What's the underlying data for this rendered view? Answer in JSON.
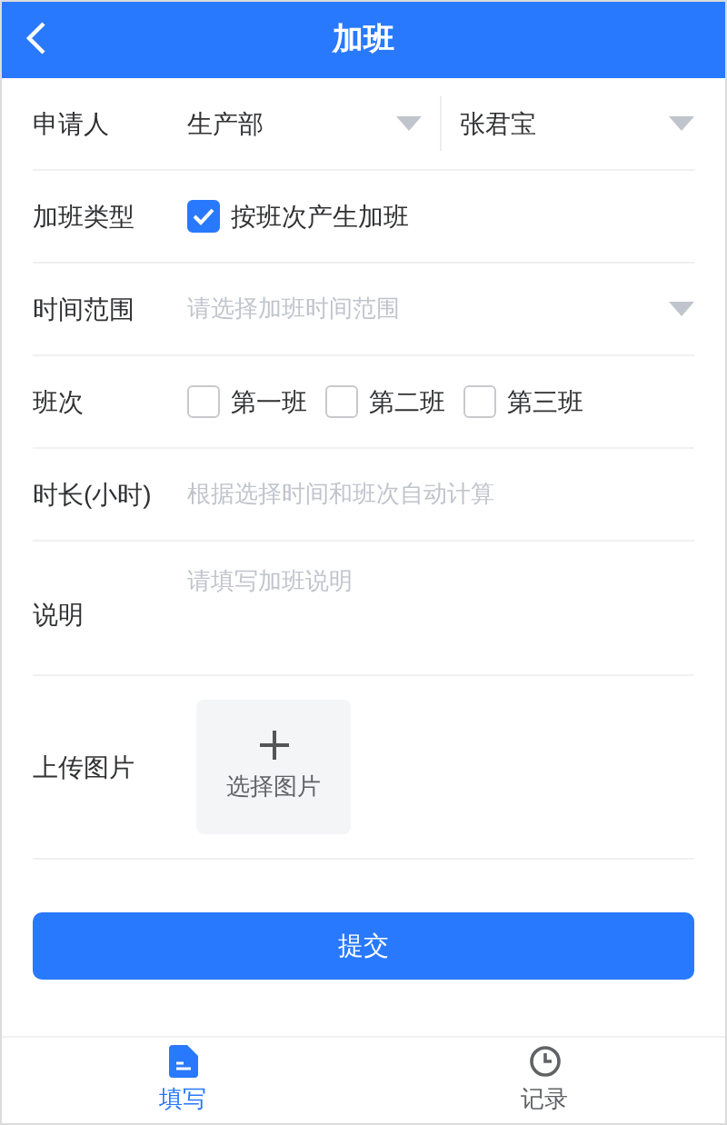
{
  "header": {
    "title": "加班"
  },
  "applicant": {
    "label": "申请人",
    "department": "生产部",
    "person": "张君宝"
  },
  "type": {
    "label": "加班类型",
    "option": "按班次产生加班",
    "checked": true
  },
  "time_range": {
    "label": "时间范围",
    "placeholder": "请选择加班时间范围"
  },
  "shifts": {
    "label": "班次",
    "options": [
      {
        "label": "第一班",
        "checked": false
      },
      {
        "label": "第二班",
        "checked": false
      },
      {
        "label": "第三班",
        "checked": false
      }
    ]
  },
  "duration": {
    "label": "时长(小时)",
    "placeholder": "根据选择时间和班次自动计算"
  },
  "note": {
    "label": "说明",
    "placeholder": "请填写加班说明"
  },
  "upload": {
    "label": "上传图片",
    "button": "选择图片"
  },
  "submit": "提交",
  "tabs": [
    {
      "label": "填写",
      "selected": true,
      "kind": "form"
    },
    {
      "label": "记录",
      "selected": false,
      "kind": "history"
    }
  ]
}
